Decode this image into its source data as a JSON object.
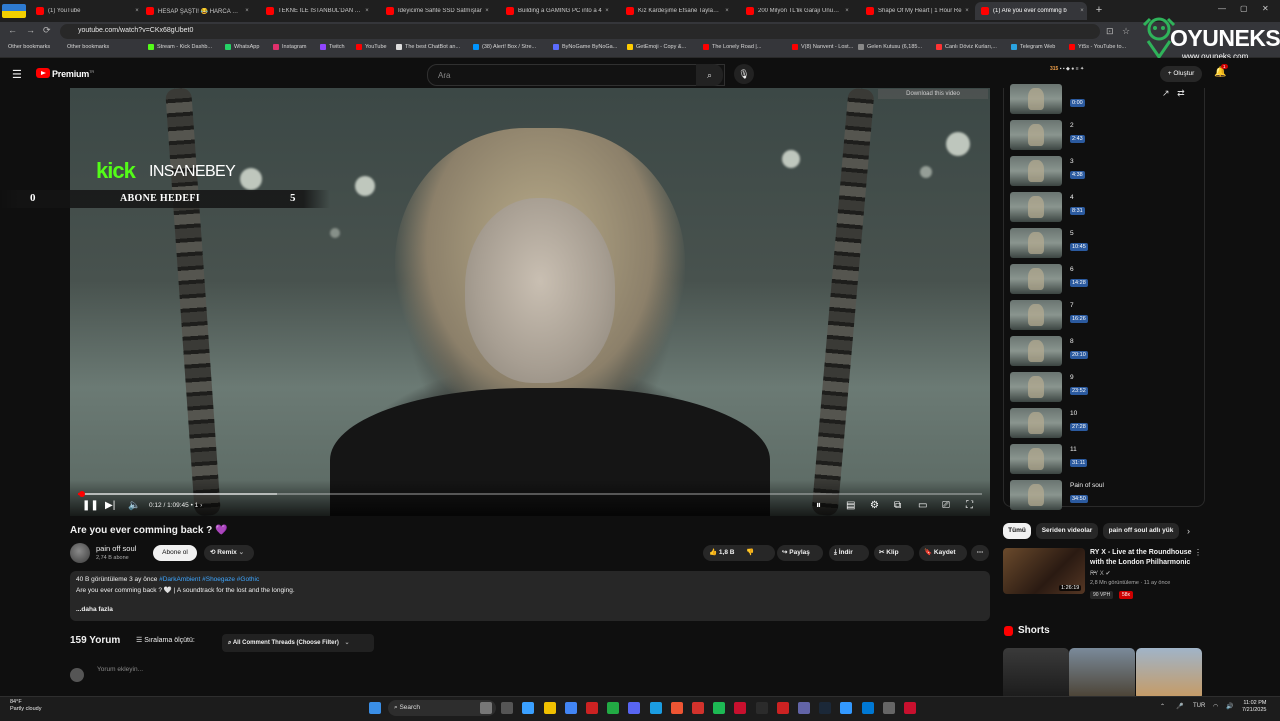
{
  "browser": {
    "tabs": [
      {
        "title": "(1) YouTube"
      },
      {
        "title": "HESAP ŞAŞTI! 😂 HARCA HARC"
      },
      {
        "title": "TEKNE İLE İSTANBUL'DAN ANT"
      },
      {
        "title": "İdeyicime Sahte SSD Satmışlar"
      },
      {
        "title": "Building a GAMING PC into a 4"
      },
      {
        "title": "Kız Kardeşime Efsane Tayland T"
      },
      {
        "title": "200 Milyon TL'lik Garajı Unus, H"
      },
      {
        "title": "Shape Of My Heart | 1 Hour Re"
      },
      {
        "title": "(1) Are you ever comming b"
      }
    ],
    "url": "youtube.com/watch?v=CKx68gUbet0",
    "bookmarks": [
      "Other bookmarks",
      "Other bookmarks",
      "Stream - Kick Dashb...",
      "WhatsApp",
      "Instagram",
      "Twitch",
      "YouTube",
      "The best ChatBot an...",
      "(38) Alert! Box / Stre...",
      "ByNoGame ByNoGa...",
      "GetEmoji - Copy &...",
      "The Lonely Road |...",
      "V(8) Nanvent - Lost...",
      "Gelen Kutusu (6,185...",
      "Canlı Döviz Kurları,...",
      "Telegram Web",
      "Yt5s - YouTube to..."
    ]
  },
  "watermark": {
    "brand": "OYUNEKS",
    "url": "www.oyuneks.com"
  },
  "header": {
    "logo": "Premium",
    "logo_sup": "TR",
    "search_placeholder": "Ara",
    "create_label": "Oluştur",
    "notif_count": "1",
    "ext_counter": "315"
  },
  "player": {
    "download_banner": "Download this video",
    "overlay": {
      "kick": "kick",
      "user": "INSANEBEY",
      "goal_current": "0",
      "goal_label": "ABONE HEDEFI",
      "goal_target": "5"
    },
    "time": "0:12 / 1:09:45",
    "chapter": "• 1 ›",
    "progress_fraction": 0.003
  },
  "video": {
    "title": "Are you ever comming back ? 💜",
    "channel": "pain off soul",
    "subs": "2,74 B abone",
    "subscribe_label": "Abone ol",
    "remix_label": "Remix",
    "likes": "1,8 B",
    "share": "Paylaş",
    "download": "İndir",
    "clip": "Klip",
    "save": "Kaydet",
    "desc_meta": "40 B görüntüleme  3 ay önce",
    "desc_tags": "#DarkAmbient #Shoegaze #Gothic",
    "desc_text": "Are you ever comming back ? 🤍 | A soundtrack for the lost and the longing.",
    "desc_more": "...daha fazla"
  },
  "comments": {
    "count": "159 Yorum",
    "sort_label": "Sıralama ölçütü:",
    "filter_label": "All Comment Threads (Choose Filter)",
    "input_placeholder": "Yorum ekleyin..."
  },
  "playlist": [
    {
      "num": "",
      "dur": "0:00"
    },
    {
      "num": "2",
      "dur": "2:43"
    },
    {
      "num": "3",
      "dur": "4:38"
    },
    {
      "num": "4",
      "dur": "8:31"
    },
    {
      "num": "5",
      "dur": "10:45"
    },
    {
      "num": "6",
      "dur": "14:28"
    },
    {
      "num": "7",
      "dur": "16:26"
    },
    {
      "num": "8",
      "dur": "20:10"
    },
    {
      "num": "9",
      "dur": "23:52"
    },
    {
      "num": "10",
      "dur": "27:28"
    },
    {
      "num": "11",
      "dur": "31:11"
    },
    {
      "num": "Pain of soul",
      "dur": "34:50"
    }
  ],
  "chips": [
    "Tümü",
    "Seriden videolar",
    "pain off soul adlı yük"
  ],
  "recommended": {
    "title": "RY X - Live at the Roundhouse with the London Philharmonic ...",
    "channel": "RY X",
    "views": "2,8 Mn görüntüleme · 11 ay önce",
    "duration": "1:26:19",
    "badge1": "90 VPH",
    "badge2": "58x"
  },
  "shorts_label": "Shorts",
  "taskbar": {
    "temp": "84°F",
    "weather": "Partly cloudy",
    "search": "Search",
    "lang": "TUR",
    "time": "11:02 PM",
    "date": "7/21/2025"
  }
}
